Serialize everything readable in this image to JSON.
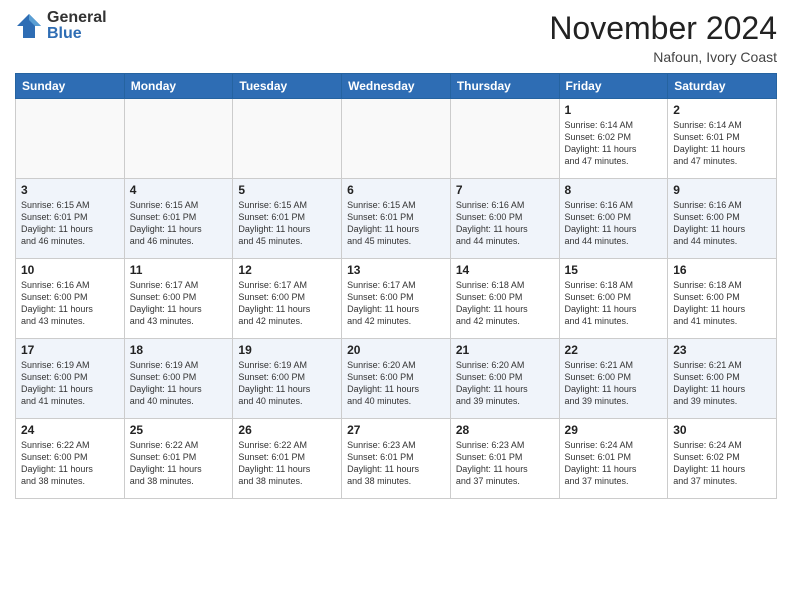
{
  "header": {
    "logo_general": "General",
    "logo_blue": "Blue",
    "month_title": "November 2024",
    "location": "Nafoun, Ivory Coast"
  },
  "weekdays": [
    "Sunday",
    "Monday",
    "Tuesday",
    "Wednesday",
    "Thursday",
    "Friday",
    "Saturday"
  ],
  "weeks": [
    [
      {
        "day": "",
        "info": ""
      },
      {
        "day": "",
        "info": ""
      },
      {
        "day": "",
        "info": ""
      },
      {
        "day": "",
        "info": ""
      },
      {
        "day": "",
        "info": ""
      },
      {
        "day": "1",
        "info": "Sunrise: 6:14 AM\nSunset: 6:02 PM\nDaylight: 11 hours\nand 47 minutes."
      },
      {
        "day": "2",
        "info": "Sunrise: 6:14 AM\nSunset: 6:01 PM\nDaylight: 11 hours\nand 47 minutes."
      }
    ],
    [
      {
        "day": "3",
        "info": "Sunrise: 6:15 AM\nSunset: 6:01 PM\nDaylight: 11 hours\nand 46 minutes."
      },
      {
        "day": "4",
        "info": "Sunrise: 6:15 AM\nSunset: 6:01 PM\nDaylight: 11 hours\nand 46 minutes."
      },
      {
        "day": "5",
        "info": "Sunrise: 6:15 AM\nSunset: 6:01 PM\nDaylight: 11 hours\nand 45 minutes."
      },
      {
        "day": "6",
        "info": "Sunrise: 6:15 AM\nSunset: 6:01 PM\nDaylight: 11 hours\nand 45 minutes."
      },
      {
        "day": "7",
        "info": "Sunrise: 6:16 AM\nSunset: 6:00 PM\nDaylight: 11 hours\nand 44 minutes."
      },
      {
        "day": "8",
        "info": "Sunrise: 6:16 AM\nSunset: 6:00 PM\nDaylight: 11 hours\nand 44 minutes."
      },
      {
        "day": "9",
        "info": "Sunrise: 6:16 AM\nSunset: 6:00 PM\nDaylight: 11 hours\nand 44 minutes."
      }
    ],
    [
      {
        "day": "10",
        "info": "Sunrise: 6:16 AM\nSunset: 6:00 PM\nDaylight: 11 hours\nand 43 minutes."
      },
      {
        "day": "11",
        "info": "Sunrise: 6:17 AM\nSunset: 6:00 PM\nDaylight: 11 hours\nand 43 minutes."
      },
      {
        "day": "12",
        "info": "Sunrise: 6:17 AM\nSunset: 6:00 PM\nDaylight: 11 hours\nand 42 minutes."
      },
      {
        "day": "13",
        "info": "Sunrise: 6:17 AM\nSunset: 6:00 PM\nDaylight: 11 hours\nand 42 minutes."
      },
      {
        "day": "14",
        "info": "Sunrise: 6:18 AM\nSunset: 6:00 PM\nDaylight: 11 hours\nand 42 minutes."
      },
      {
        "day": "15",
        "info": "Sunrise: 6:18 AM\nSunset: 6:00 PM\nDaylight: 11 hours\nand 41 minutes."
      },
      {
        "day": "16",
        "info": "Sunrise: 6:18 AM\nSunset: 6:00 PM\nDaylight: 11 hours\nand 41 minutes."
      }
    ],
    [
      {
        "day": "17",
        "info": "Sunrise: 6:19 AM\nSunset: 6:00 PM\nDaylight: 11 hours\nand 41 minutes."
      },
      {
        "day": "18",
        "info": "Sunrise: 6:19 AM\nSunset: 6:00 PM\nDaylight: 11 hours\nand 40 minutes."
      },
      {
        "day": "19",
        "info": "Sunrise: 6:19 AM\nSunset: 6:00 PM\nDaylight: 11 hours\nand 40 minutes."
      },
      {
        "day": "20",
        "info": "Sunrise: 6:20 AM\nSunset: 6:00 PM\nDaylight: 11 hours\nand 40 minutes."
      },
      {
        "day": "21",
        "info": "Sunrise: 6:20 AM\nSunset: 6:00 PM\nDaylight: 11 hours\nand 39 minutes."
      },
      {
        "day": "22",
        "info": "Sunrise: 6:21 AM\nSunset: 6:00 PM\nDaylight: 11 hours\nand 39 minutes."
      },
      {
        "day": "23",
        "info": "Sunrise: 6:21 AM\nSunset: 6:00 PM\nDaylight: 11 hours\nand 39 minutes."
      }
    ],
    [
      {
        "day": "24",
        "info": "Sunrise: 6:22 AM\nSunset: 6:00 PM\nDaylight: 11 hours\nand 38 minutes."
      },
      {
        "day": "25",
        "info": "Sunrise: 6:22 AM\nSunset: 6:01 PM\nDaylight: 11 hours\nand 38 minutes."
      },
      {
        "day": "26",
        "info": "Sunrise: 6:22 AM\nSunset: 6:01 PM\nDaylight: 11 hours\nand 38 minutes."
      },
      {
        "day": "27",
        "info": "Sunrise: 6:23 AM\nSunset: 6:01 PM\nDaylight: 11 hours\nand 38 minutes."
      },
      {
        "day": "28",
        "info": "Sunrise: 6:23 AM\nSunset: 6:01 PM\nDaylight: 11 hours\nand 37 minutes."
      },
      {
        "day": "29",
        "info": "Sunrise: 6:24 AM\nSunset: 6:01 PM\nDaylight: 11 hours\nand 37 minutes."
      },
      {
        "day": "30",
        "info": "Sunrise: 6:24 AM\nSunset: 6:02 PM\nDaylight: 11 hours\nand 37 minutes."
      }
    ]
  ]
}
